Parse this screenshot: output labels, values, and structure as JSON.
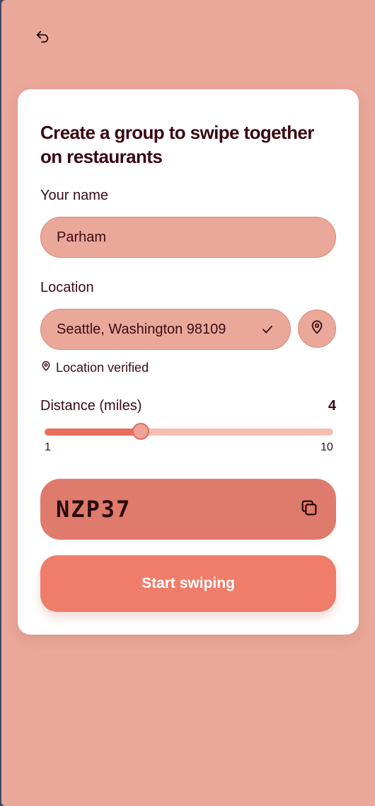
{
  "header": {
    "back_icon": "undo-arrow-icon"
  },
  "form": {
    "title": "Create a group to swipe together on restaurants",
    "name_label": "Your name",
    "name_value": "Parham",
    "location_label": "Location",
    "location_value": "Seattle, Washington 98109",
    "location_status_icon": "check-icon",
    "locate_button_icon": "map-pin-icon",
    "verified_text": "Location verified",
    "distance_label": "Distance (miles)",
    "distance_value": "4",
    "distance_min": "1",
    "distance_max": "10",
    "distance_numeric": 4,
    "distance_range": [
      1,
      10
    ],
    "group_code": "NZP37",
    "copy_icon": "copy-icon",
    "start_button": "Start swiping"
  },
  "colors": {
    "background": "#eaa89a",
    "card": "#ffffff",
    "accent": "#f07c6a",
    "code_box": "#df7b6c",
    "slider_fill": "#ea6e5c",
    "slider_track": "#f7beb3",
    "text": "#3a0b12"
  }
}
